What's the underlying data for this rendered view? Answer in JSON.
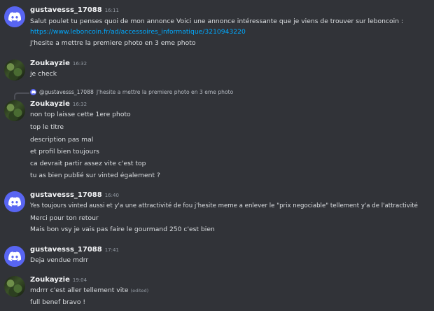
{
  "messages": [
    {
      "author": "gustavesss_17088",
      "time": "16:11",
      "lines": [
        "Salut poulet tu penses quoi de mon annonce Voici une annonce intéressante que je viens de trouver sur leboncoin :",
        "https://www.leboncoin.fr/ad/accessoires_informatique/3210943220",
        "J'hesite a mettre la premiere photo en 3 eme photo"
      ]
    },
    {
      "author": "Zoukayzie",
      "time": "16:32",
      "lines": [
        "je check"
      ]
    },
    {
      "reply_to": "@gustavesss_17088",
      "reply_text": "J'hesite a mettre la premiere photo en 3 eme photo",
      "author": "Zoukayzie",
      "time": "16:32",
      "lines": [
        "non top laisse cette 1ere photo",
        "top le titre",
        "description pas mal",
        "et profil bien toujours",
        "ca devrait partir assez vite c'est top",
        "tu as bien publié sur vinted également ?"
      ]
    },
    {
      "author": "gustavesss_17088",
      "time": "16:40",
      "lines": [
        "Yes toujours vinted aussi et y'a une attractivité de fou j'hesite meme a enlever le \"prix negociable\" tellement y'a de l'attractivité",
        "Merci pour ton retour",
        "Mais bon vsy je vais pas faire le gourmand 250 c'est bien"
      ]
    },
    {
      "author": "gustavesss_17088",
      "time": "17:41",
      "lines": [
        "Deja vendue mdrr"
      ]
    },
    {
      "author": "Zoukayzie",
      "time": "19:04",
      "lines": [
        "mdrrr c'est aller tellement vite",
        "full benef bravo !"
      ],
      "edited": "(edited)"
    }
  ]
}
